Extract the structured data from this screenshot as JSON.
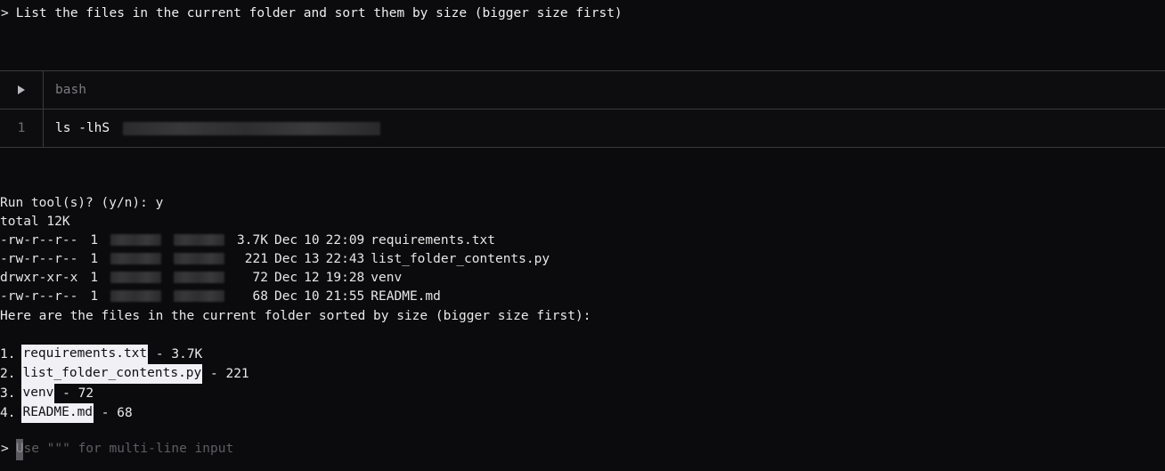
{
  "theme": {
    "background": "#0b0b0d",
    "foreground": "#e8e8e8",
    "dim": "#6e6e72",
    "border": "#3a3a3c",
    "inline_code_bg": "#f1f0f5",
    "inline_code_fg": "#101013",
    "cursor_bg": "#5a5a5f"
  },
  "user_prompt": {
    "chevron": ">",
    "text": "List the files in the current folder and sort them by size (bigger size first)"
  },
  "tool_block": {
    "run_icon": "play-triangle-icon",
    "language": "bash",
    "line_number": "1",
    "command": "ls -lhS",
    "redacted_path": true
  },
  "terminal_output": {
    "confirm_line": "Run tool(s)? (y/n): y",
    "total_line": "total 12K",
    "listing": [
      {
        "permissions": "-rw-r--r--",
        "links": "1",
        "owner_redacted": true,
        "group_redacted": true,
        "size": "3.7K",
        "month": "Dec",
        "day": "10",
        "time": "22:09",
        "name": "requirements.txt"
      },
      {
        "permissions": "-rw-r--r--",
        "links": "1",
        "owner_redacted": true,
        "group_redacted": true,
        "size": " 221",
        "month": "Dec",
        "day": "13",
        "time": "22:43",
        "name": "list_folder_contents.py"
      },
      {
        "permissions": "drwxr-xr-x",
        "links": "1",
        "owner_redacted": true,
        "group_redacted": true,
        "size": "  72",
        "month": "Dec",
        "day": "12",
        "time": "19:28",
        "name": "venv"
      },
      {
        "permissions": "-rw-r--r--",
        "links": "1",
        "owner_redacted": true,
        "group_redacted": true,
        "size": "  68",
        "month": "Dec",
        "day": "10",
        "time": "21:55",
        "name": "README.md"
      }
    ]
  },
  "answer": {
    "intro": "Here are the files in the current folder sorted by size (bigger size first):",
    "items": [
      {
        "index": "1.",
        "name": "requirements.txt",
        "separator": " - ",
        "size": "3.7K"
      },
      {
        "index": "2.",
        "name": "list_folder_contents.py",
        "separator": " - ",
        "size": "221"
      },
      {
        "index": "3.",
        "name": "venv",
        "separator": " - ",
        "size": "72"
      },
      {
        "index": "4.",
        "name": "README.md",
        "separator": " - ",
        "size": "68"
      }
    ]
  },
  "input_prompt": {
    "chevron": ">",
    "cursor_char": "U",
    "placeholder_rest": "se \"\"\" for multi-line input"
  }
}
